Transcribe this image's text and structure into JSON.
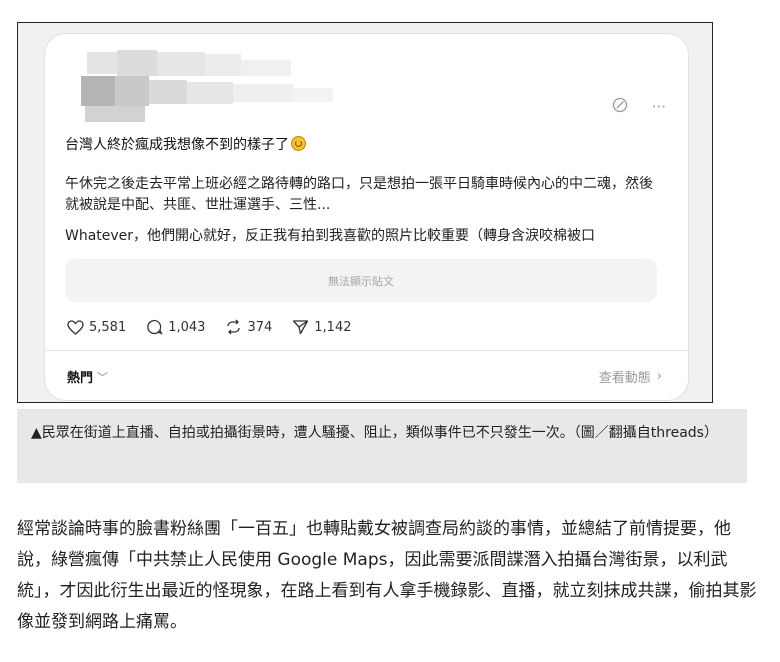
{
  "post": {
    "title": "台灣人終於瘋成我想像不到的樣子了",
    "body": [
      "午休完之後走去平常上班必經之路待轉的路口，只是想拍一張平日騎車時候內心的中二魂，然後就被說是中配、共匪、世壯運選手、三性...",
      "Whatever，他們開心就好，反正我有拍到我喜歡的照片比較重要（轉身含淚咬棉被口"
    ],
    "hidden_notice": "無法顯示貼文",
    "more_icon": "···",
    "stats": {
      "likes": "5,581",
      "comments": "1,043",
      "reposts": "374",
      "shares": "1,142"
    },
    "sort_label": "熱門",
    "view_activity": "查看動態"
  },
  "caption": "▲民眾在街道上直播、自拍或拍攝街景時，遭人騷擾、阻止，類似事件已不只發生一次。（圖／翻攝自threads）",
  "article": "經常談論時事的臉書粉絲團「一百五」也轉貼戴女被調查局約談的事情，並總結了前情提要，他說，綠營瘋傳「中共禁止人民使用 Google Maps，因此需要派間諜潛入拍攝台灣街景，以利武統」，才因此衍生出最近的怪現象，在路上看到有人拿手機錄影、直播，就立刻抹成共諜，偷拍其影像並發到網路上痛罵。"
}
